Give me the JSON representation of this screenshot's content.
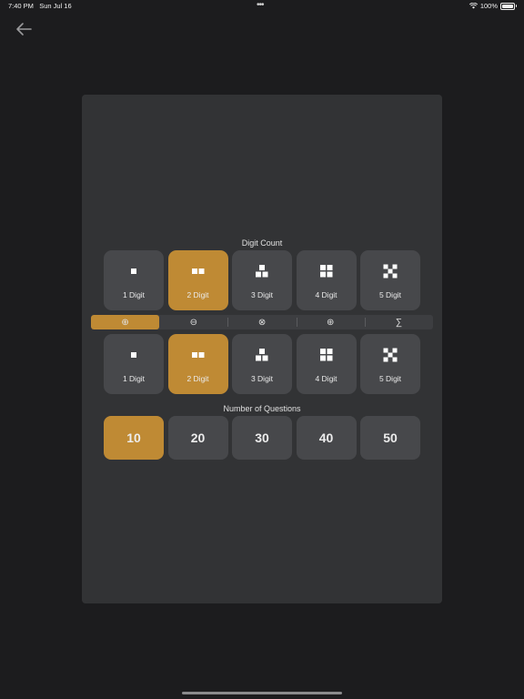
{
  "status": {
    "time": "7:40 PM",
    "date": "Sun Jul 16",
    "dots": "•••",
    "battery": "100%"
  },
  "digit_section": {
    "title": "Digit Count"
  },
  "digit_options_top": [
    {
      "label": "1 Digit",
      "selected": false
    },
    {
      "label": "2 Digit",
      "selected": true
    },
    {
      "label": "3 Digit",
      "selected": false
    },
    {
      "label": "4 Digit",
      "selected": false
    },
    {
      "label": "5 Digit",
      "selected": false
    }
  ],
  "operations": [
    {
      "symbol": "⊕",
      "name": "add",
      "selected": true
    },
    {
      "symbol": "⊖",
      "name": "subtract",
      "selected": false
    },
    {
      "symbol": "⊗",
      "name": "multiply",
      "selected": false
    },
    {
      "symbol": "⊕",
      "name": "divide",
      "selected": false
    },
    {
      "symbol": "∑",
      "name": "sum",
      "selected": false
    }
  ],
  "digit_options_bottom": [
    {
      "label": "1 Digit",
      "selected": false
    },
    {
      "label": "2 Digit",
      "selected": true
    },
    {
      "label": "3 Digit",
      "selected": false
    },
    {
      "label": "4 Digit",
      "selected": false
    },
    {
      "label": "5 Digit",
      "selected": false
    }
  ],
  "questions_section": {
    "title": "Number of Questions"
  },
  "question_options": [
    {
      "label": "10",
      "selected": true
    },
    {
      "label": "20",
      "selected": false
    },
    {
      "label": "30",
      "selected": false
    },
    {
      "label": "40",
      "selected": false
    },
    {
      "label": "50",
      "selected": false
    }
  ],
  "colors": {
    "accent": "#bf8a34",
    "panel": "#323335",
    "tile": "#47484b",
    "background": "#1c1c1e"
  }
}
